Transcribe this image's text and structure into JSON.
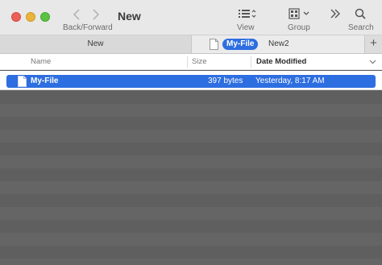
{
  "window": {
    "title": "New",
    "colors": {
      "accent": "#2d6ee0",
      "overlay": "#5f5f5f"
    }
  },
  "toolbar": {
    "back_forward_label": "Back/Forward",
    "view_label": "View",
    "group_label": "Group",
    "search_label": "Search",
    "icons": [
      "chevron-left-icon",
      "chevron-right-icon",
      "list-view-icon",
      "grid-group-icon",
      "more-chevrons-icon",
      "search-icon"
    ]
  },
  "tabs": {
    "items": [
      {
        "label": "New"
      },
      {
        "label": "My-File"
      },
      {
        "label": "New2"
      }
    ],
    "add_label": "+"
  },
  "columns": {
    "name": "Name",
    "size": "Size",
    "date": "Date Modified"
  },
  "files": [
    {
      "name": "My-File",
      "size": "397 bytes",
      "modified": "Yesterday, 8:17 AM",
      "selected": true
    }
  ]
}
